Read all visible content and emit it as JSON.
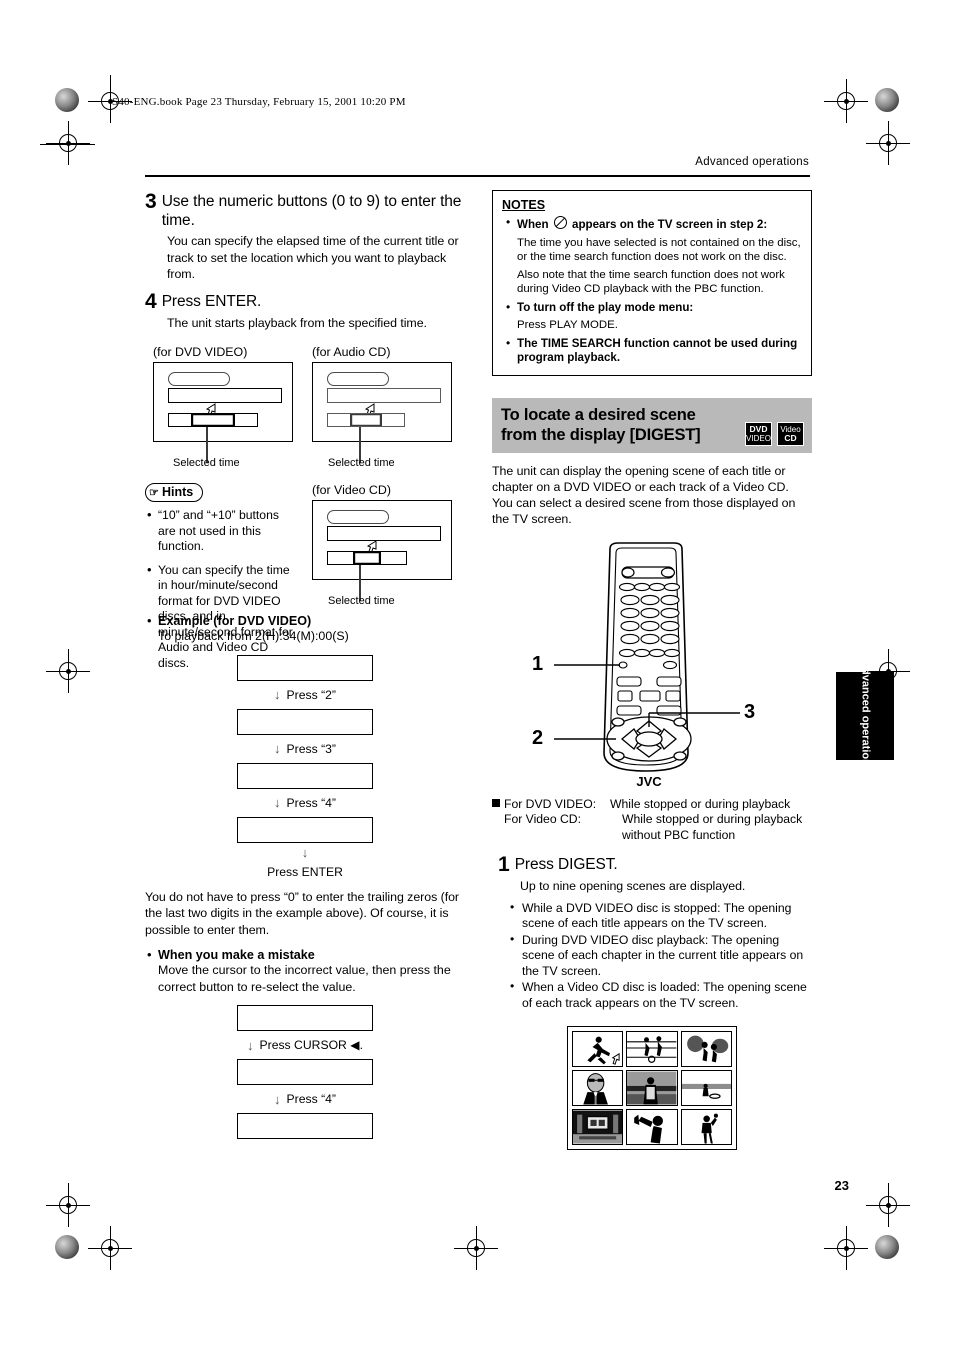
{
  "printer": {
    "file_header": "S40-ENG.book  Page 23  Thursday, February 15, 2001  10:20 PM",
    "running_header": "Advanced operations",
    "page_number": "23",
    "side_tab": "Advanced operations"
  },
  "left_column": {
    "step3": {
      "number": "3",
      "heading": "Use the numeric buttons (0 to 9) to enter the time.",
      "body": "You can specify the elapsed time of the current title or track to set the location which you want to playback from."
    },
    "step4": {
      "number": "4",
      "heading": "Press ENTER.",
      "body": "The unit starts playback from the specified time."
    },
    "figures": [
      {
        "caption": "(for DVD VIDEO)",
        "selected_label": "Selected time"
      },
      {
        "caption": "(for Audio CD)",
        "selected_label": "Selected time"
      },
      {
        "caption": "(for Video CD)",
        "selected_label": "Selected time"
      }
    ],
    "hints": {
      "title": "Hints",
      "items": [
        "“10” and “+10” buttons are not used in this function.",
        "You can specify the time in hour/minute/second format for DVD VIDEO discs, and in minute/second format for Audio and Video CD discs."
      ]
    },
    "example": {
      "heading": "Example (for DVD VIDEO)",
      "subtext": "To playback from 2(H):34(M):00(S)",
      "steps": [
        "Press “2”",
        "Press “3”",
        "Press “4”"
      ],
      "final": "Press ENTER"
    },
    "note_text": "You do not have to press “0” to enter the trailing zeros (for the last two digits in the example above). Of course, it is possible to enter them.",
    "mistake": {
      "heading": "When you make a mistake",
      "body": "Move the cursor to the incorrect value, then press the correct button to re-select the value.",
      "steps": [
        "Press CURSOR ◀.",
        "Press “4”"
      ]
    }
  },
  "right_column": {
    "notes": {
      "title": "NOTES",
      "items": [
        {
          "bold_prefix": "When ",
          "icon": "prohibition-icon",
          "bold_suffix": " appears on the TV screen in step 2:",
          "paragraphs": [
            "The time you have selected is not contained on the disc, or the time search function does not work on the disc.",
            "Also note that the time search function does not work during Video CD playback with the PBC function."
          ]
        },
        {
          "bold": "To turn off the play mode menu:",
          "paragraphs": [
            "Press PLAY MODE."
          ]
        },
        {
          "bold": "The TIME SEARCH function cannot be used during program playback.",
          "paragraphs": []
        }
      ]
    },
    "section": {
      "title": "To locate a desired scene from the display [DIGEST]",
      "badges": [
        {
          "line1": "DVD",
          "line2": "VIDEO"
        },
        {
          "line1": "Video",
          "line2": "CD"
        }
      ],
      "intro": "The unit can display the opening scene of each title or chapter on a DVD VIDEO or each track of a Video CD.  You can select a desired scene from those displayed on the TV screen."
    },
    "remote": {
      "brand": "JVC",
      "callouts": [
        "1",
        "2",
        "3"
      ]
    },
    "modes": [
      {
        "label": "For DVD VIDEO:",
        "value": "While stopped or during playback"
      },
      {
        "label": "For Video CD:",
        "value": "While stopped or during playback without PBC function"
      }
    ],
    "step1": {
      "number": "1",
      "heading": "Press DIGEST.",
      "body": "Up to nine opening scenes are displayed."
    },
    "bullets": [
      "While a DVD VIDEO disc is stopped: The opening scene of each title appears on the TV screen.",
      "During DVD VIDEO disc playback: The opening scene of each chapter in the current title appears on the TV screen.",
      "When a Video CD disc is loaded: The opening scene of each track appears on the TV screen."
    ],
    "digest_grid": {
      "rows": 3,
      "cols": 3,
      "scenes": [
        "runner-scene",
        "soccer-scene",
        "table-tennis-scene",
        "portrait-scene",
        "street-scene",
        "beach-scene",
        "stage-scene",
        "trumpet-scene",
        "person-scene"
      ]
    }
  }
}
